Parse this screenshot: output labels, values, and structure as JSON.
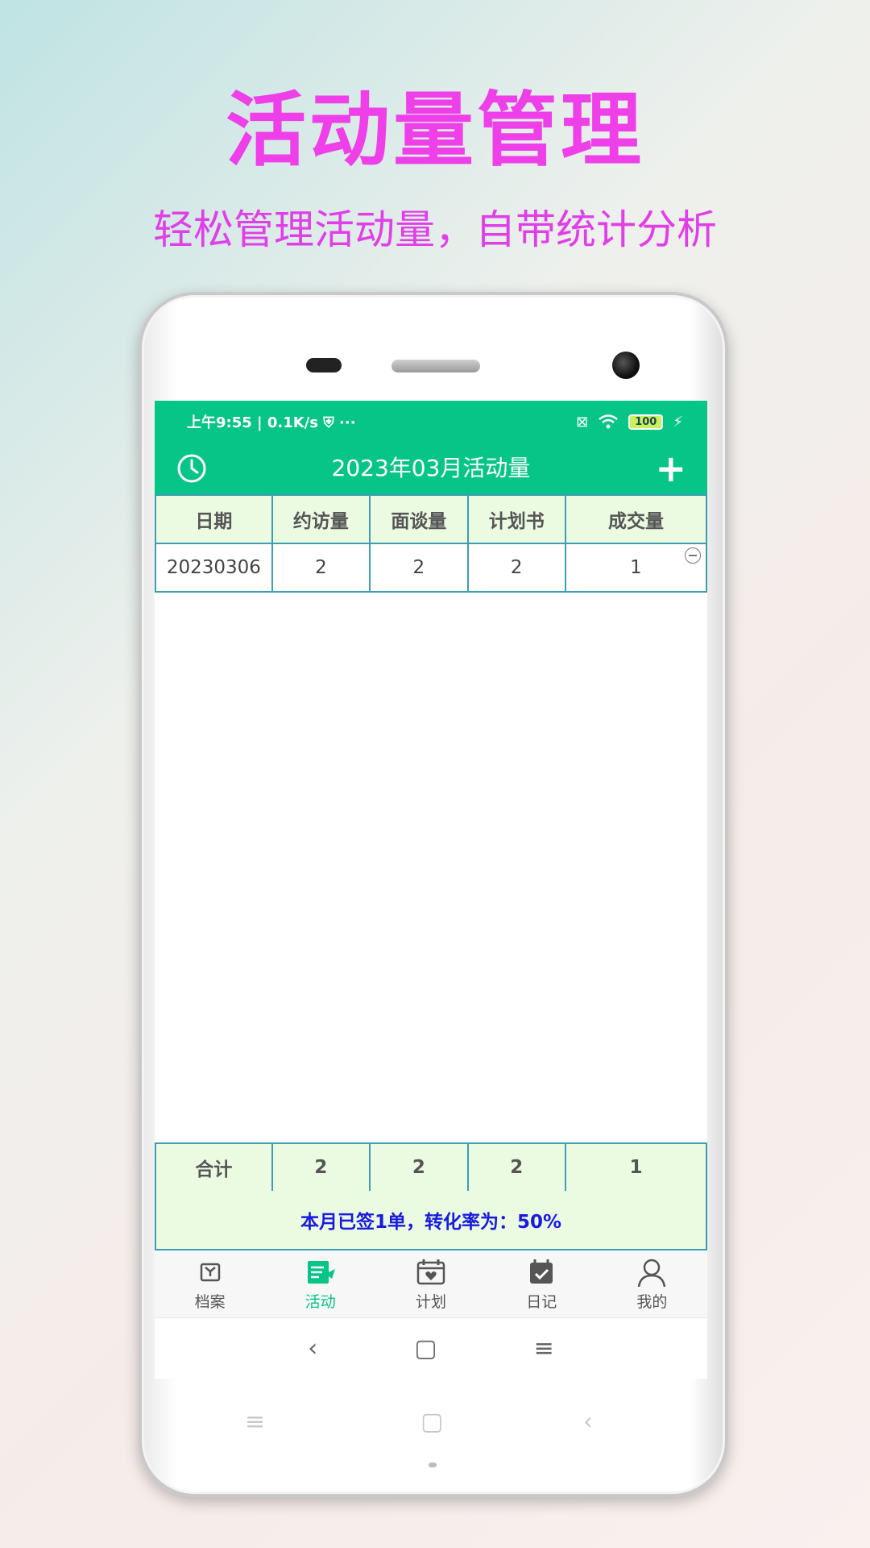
{
  "promo": {
    "title": "活动量管理",
    "subtitle": "轻松管理活动量，自带统计分析"
  },
  "status_bar": {
    "time_info": "上午9:55 | 0.1K/s  ⛨  ···",
    "battery": "100"
  },
  "app_bar": {
    "title": "2023年03月活动量",
    "add_label": "+"
  },
  "table": {
    "headers": [
      "日期",
      "约访量",
      "面谈量",
      "计划书",
      "成交量"
    ],
    "rows": [
      [
        "20230306",
        "2",
        "2",
        "2",
        "1"
      ]
    ],
    "totals": [
      "合计",
      "2",
      "2",
      "2",
      "1"
    ]
  },
  "summary": "本月已签1单，转化率为：50%",
  "bottom_nav": [
    {
      "label": "档案",
      "icon": "archive-icon"
    },
    {
      "label": "活动",
      "icon": "activity-icon",
      "active": true
    },
    {
      "label": "计划",
      "icon": "plan-icon"
    },
    {
      "label": "日记",
      "icon": "diary-icon"
    },
    {
      "label": "我的",
      "icon": "profile-icon"
    }
  ],
  "colors": {
    "accent": "#07c487",
    "promo": "#ee3fe9",
    "summary_text": "#1a1ae0",
    "cell_bg": "#eafbe2",
    "grid_border": "#3e9cb3"
  },
  "sys_nav": {
    "back": "‹",
    "home": "▢",
    "menu": "≡"
  }
}
